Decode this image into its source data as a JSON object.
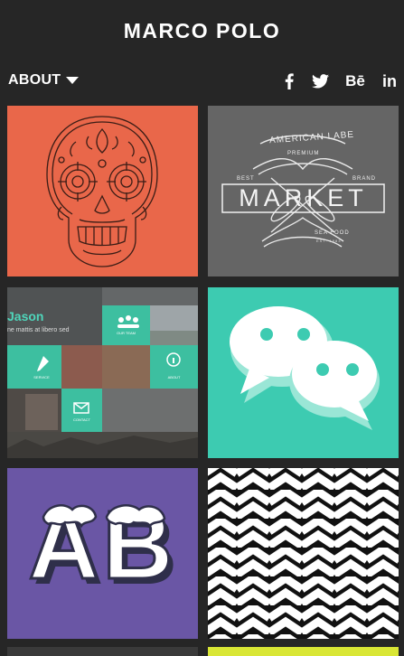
{
  "header": {
    "title": "MARCO POLO"
  },
  "nav": {
    "about_label": "ABOUT",
    "social": [
      {
        "icon": "facebook-icon",
        "label": "f"
      },
      {
        "icon": "twitter-icon",
        "label": ""
      },
      {
        "icon": "behance-icon",
        "label": "Bē"
      },
      {
        "icon": "linkedin-icon",
        "label": "in"
      }
    ]
  },
  "portfolio": {
    "tiles": [
      {
        "icon": "sugar-skull-icon",
        "color": "#e9674a"
      },
      {
        "icon": "market-logo-icon",
        "color": "#656565",
        "texts": {
          "top": "AMERICAN LABE",
          "premium": "PREMIUM",
          "best": "BEST",
          "brand": "BRAND",
          "main": "MARKET",
          "sea": "SEA FOOD",
          "est": "EST. 1983"
        }
      },
      {
        "icon": "website-mockup-icon",
        "color": "#5a5a5a",
        "texts": {
          "brand": "Jason",
          "tagline": "ne mattis at libero sed",
          "team": "OUR TEAM",
          "service": "SERVICE",
          "about": "ABOUT",
          "contact": "CONTACT"
        }
      },
      {
        "icon": "chat-bubbles-icon",
        "color": "#3dcbb1"
      },
      {
        "icon": "ab-letters-icon",
        "color": "#6a56a5",
        "texts": {
          "main": "AB"
        }
      },
      {
        "icon": "zigzag-pattern-icon",
        "color": "#111111"
      }
    ]
  }
}
